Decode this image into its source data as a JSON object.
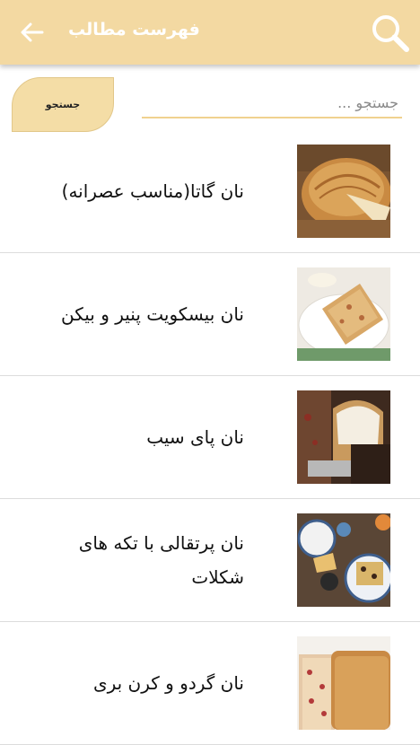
{
  "app_bar": {
    "title": "فهرست مطالب",
    "back_icon": "arrow-left-icon",
    "search_icon": "search-icon",
    "background": "#f3d9a2"
  },
  "search": {
    "placeholder": "جستجو ...",
    "value": "",
    "button_label": "جستجو"
  },
  "items": [
    {
      "title": "نان گاتا(مناسب عصرانه)",
      "image": "gata-bread-photo"
    },
    {
      "title": "نان بیسکویت پنیر و بیکن",
      "image": "cheese-bacon-scone-photo"
    },
    {
      "title": "نان پای سیب",
      "image": "apple-pie-bread-photo"
    },
    {
      "title": "نان پرتقالی با تکه های شکلات",
      "image": "orange-chocolate-bread-photo"
    },
    {
      "title": "نان گردو و کرن بری",
      "image": "walnut-cranberry-bread-photo"
    }
  ]
}
